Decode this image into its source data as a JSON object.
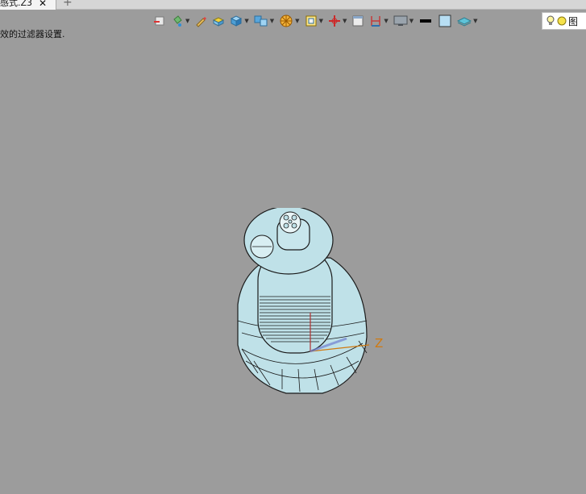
{
  "tab": {
    "label": "感式.Z3",
    "close_glyph": "✕",
    "add_glyph": "+"
  },
  "status": {
    "message": "效的过滤器设置."
  },
  "filter": {
    "text": "图"
  },
  "axis": {
    "z_label": "Z"
  },
  "toolbar": {
    "icons": [
      "select-filter-icon",
      "paint-bucket-icon",
      "pencil-icon",
      "box-solid-icon",
      "cube-view-icon",
      "shaded-cubes-icon",
      "wheel-icon",
      "zoom-frame-icon",
      "axis-cross-icon",
      "window-icon",
      "dimension-icon",
      "display-screen-icon",
      "line-color-icon",
      "face-color-icon",
      "layer-icon",
      "bulb-icon"
    ]
  },
  "colors": {
    "viewport": "#9c9c9c",
    "part": "#bfe1e8",
    "axis_label": "#d07a10"
  }
}
